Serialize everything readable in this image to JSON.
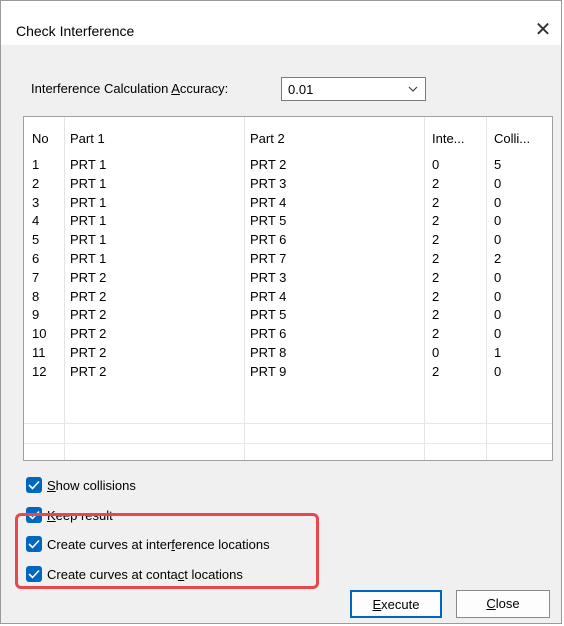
{
  "dialog": {
    "title": "Check Interference",
    "close_icon": "close-icon"
  },
  "accuracy": {
    "label_pre": "Interference Calculation ",
    "label_key": "A",
    "label_post": "ccuracy:",
    "value": "0.01"
  },
  "table": {
    "headers": [
      "No",
      "Part 1",
      "Part 2",
      "Inte...",
      "Colli..."
    ],
    "rows": [
      [
        "1",
        "PRT 1",
        "PRT 2",
        "0",
        "5"
      ],
      [
        "2",
        "PRT 1",
        "PRT 3",
        "2",
        "0"
      ],
      [
        "3",
        "PRT 1",
        "PRT 4",
        "2",
        "0"
      ],
      [
        "4",
        "PRT 1",
        "PRT 5",
        "2",
        "0"
      ],
      [
        "5",
        "PRT 1",
        "PRT 6",
        "2",
        "0"
      ],
      [
        "6",
        "PRT 1",
        "PRT 7",
        "2",
        "2"
      ],
      [
        "7",
        "PRT 2",
        "PRT 3",
        "2",
        "0"
      ],
      [
        "8",
        "PRT 2",
        "PRT 4",
        "2",
        "0"
      ],
      [
        "9",
        "PRT 2",
        "PRT 5",
        "2",
        "0"
      ],
      [
        "10",
        "PRT 2",
        "PRT 6",
        "2",
        "0"
      ],
      [
        "11",
        "PRT 2",
        "PRT 8",
        "0",
        "1"
      ],
      [
        "12",
        "PRT 2",
        "PRT 9",
        "2",
        "0"
      ]
    ]
  },
  "options": [
    {
      "pre": "",
      "key": "S",
      "post": "how collisions",
      "checked": true
    },
    {
      "pre": "",
      "key": "K",
      "post": "eep result",
      "checked": true
    },
    {
      "pre": "Create curves at inter",
      "key": "f",
      "post": "erence locations",
      "checked": true
    },
    {
      "pre": "Create curves at conta",
      "key": "c",
      "post": "t locations",
      "checked": true
    }
  ],
  "buttons": {
    "execute_key": "E",
    "execute_post": "xecute",
    "close_key": "C",
    "close_post": "lose"
  },
  "colors": {
    "accent": "#0067c0",
    "highlight": "#e8484c"
  }
}
